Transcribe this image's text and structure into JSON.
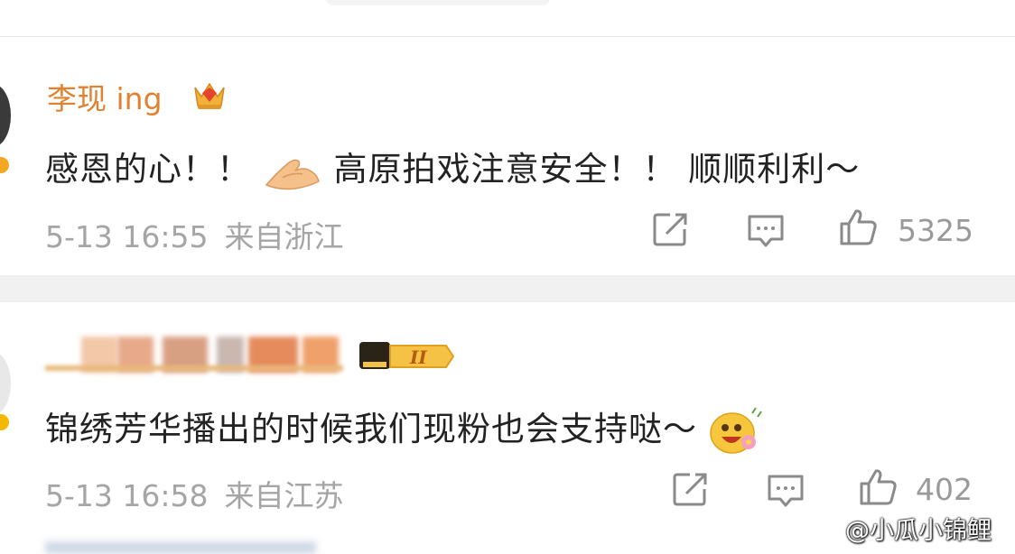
{
  "comments": [
    {
      "username": "李现 ing",
      "text_before_emoji": "感恩的心！！",
      "text_after_emoji": "高原拍戏注意安全！！ 顺顺利利～",
      "date": "5-13 16:55",
      "source": "来自浙江",
      "likes": "5325",
      "emoji": "praying-hands-icon"
    },
    {
      "username": "",
      "text": "锦绣芳华播出的时候我们现粉也会支持哒～",
      "date": "5-13 16:58",
      "source": "来自江苏",
      "likes": "402",
      "emoji": "happy-flower-face-icon",
      "badge_level": "II"
    }
  ],
  "watermark": "@小瓜小锦鲤",
  "colors": {
    "username": "#e0822f",
    "body_text": "#222222",
    "meta_text": "#a5a5a5",
    "divider": "#f1f1f1"
  }
}
